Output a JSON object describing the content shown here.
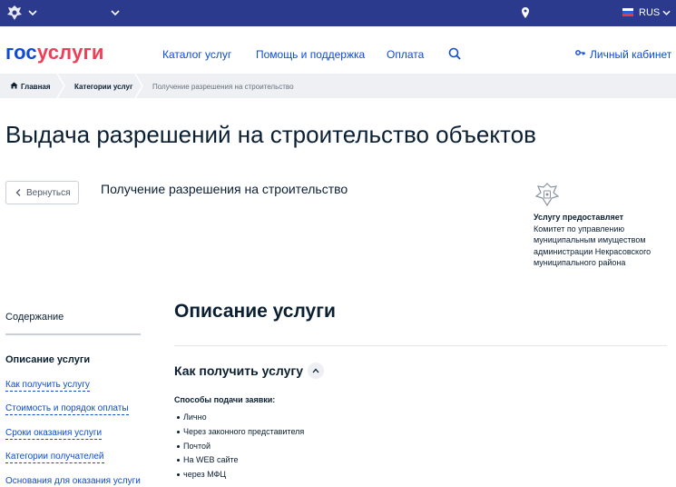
{
  "colors": {
    "topbar": "#2b3a8c",
    "link": "#0d4cd3",
    "logo_red": "#ee3f58",
    "text": "#0b1f33",
    "breadcrumb_bg": "#eef0f3"
  },
  "topbar": {
    "emblem_icon": "coat-of-arms-icon",
    "location_icon": "map-pin-icon",
    "language": "RUS"
  },
  "header": {
    "logo_part1": "гос",
    "logo_part2": "услуги",
    "nav": {
      "catalog": "Каталог услуг",
      "help": "Помощь и поддержка",
      "payment": "Оплата"
    },
    "search_icon": "search-icon",
    "cabinet": "Личный кабинет"
  },
  "breadcrumb": {
    "home": "Главная",
    "categories": "Категории услуг",
    "current": "Получение разрешения на строительство"
  },
  "page": {
    "title": "Выдача разрешений на строительство объектов",
    "back_label": "Вернуться",
    "service_name": "Получение разрешения на строительство",
    "provider_title": "Услугу предоставляет",
    "provider_lines": [
      "Комитет по управлению",
      "муниципальным имуществом",
      "администрации Некрасовского",
      "муниципального района"
    ]
  },
  "sidebar": {
    "heading": "Содержание",
    "active": "Описание услуги",
    "links": [
      "Как получить услугу",
      "Стоимость и порядок оплаты",
      "Сроки оказания услуги",
      "Категории получателей",
      "Основания для оказания услуги"
    ]
  },
  "main": {
    "section_title": "Описание услуги",
    "how_title": "Как получить услугу",
    "methods_title": "Способы подачи заявки:",
    "methods": [
      "Лично",
      "Через законного представителя",
      "Почтой",
      "На WEB сайте",
      "через МФЦ"
    ]
  }
}
